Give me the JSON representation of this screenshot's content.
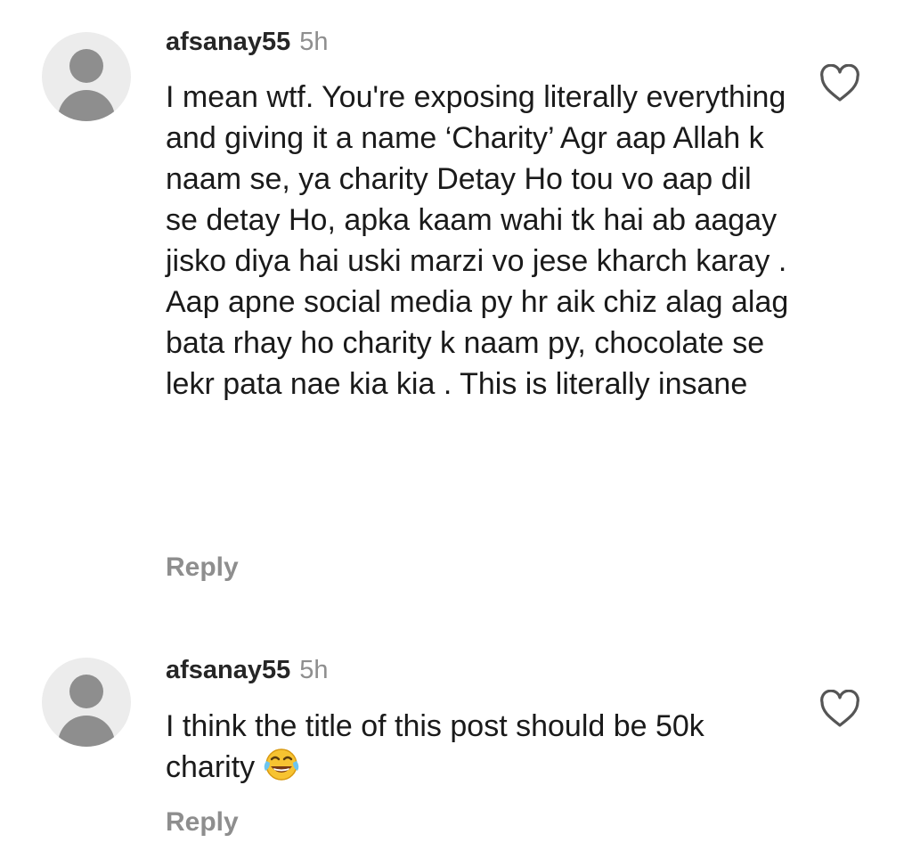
{
  "comments": [
    {
      "username": "afsanay55",
      "time": "5h",
      "text": "I mean wtf. You're exposing literally everything and giving it a name ‘Charity’ Agr aap Allah k naam se, ya charity Detay Ho tou vo aap dil se detay Ho, apka kaam wahi tk hai ab aagay jisko diya hai uski marzi vo jese kharch karay . Aap apne social media py hr aik chiz alag alag bata rhay ho charity k naam py, chocolate se lekr pata nae kia kia . This is literally insane",
      "reply_label": "Reply",
      "like_icon": "heart-outline-icon"
    },
    {
      "username": "afsanay55",
      "time": "5h",
      "text": "I think the title of this post should be 50k charity",
      "emoji": "face-with-tears-of-joy-icon",
      "reply_label": "Reply",
      "like_icon": "heart-outline-icon"
    }
  ],
  "colors": {
    "text": "#1a1a1a",
    "muted": "#8e8e8e",
    "avatar_bg": "#ececec",
    "avatar_fg": "#8e8e8e"
  }
}
